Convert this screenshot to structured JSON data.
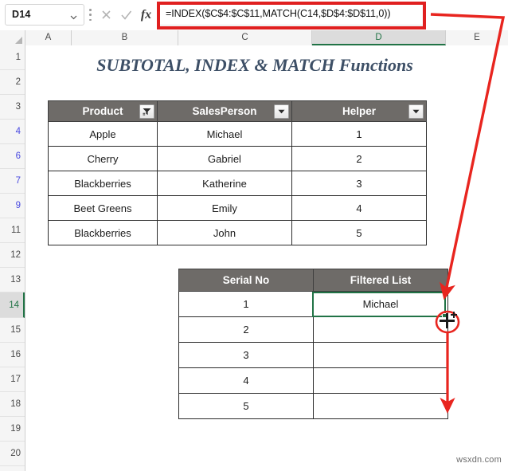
{
  "app": "spreadsheet",
  "formula_bar": {
    "name_box_value": "D14",
    "name_box_chevron_icon": "chevron-down-icon",
    "cancel_icon": "cancel-x-icon",
    "enter_icon": "enter-check-icon",
    "insert_function_icon": "fx-icon",
    "insert_function_label": "fx",
    "formula": "=INDEX($C$4:$C$11,MATCH(C14,$D$4:$D$11,0))",
    "highlight_color": "#e02020"
  },
  "column_headers": [
    "A",
    "B",
    "C",
    "D",
    "E"
  ],
  "selected_column": "D",
  "row_headers": [
    "1",
    "2",
    "3",
    "4",
    "6",
    "7",
    "9",
    "11",
    "12",
    "13",
    "14",
    "15",
    "16",
    "17",
    "18",
    "19",
    "20"
  ],
  "filtered_rows": [
    "4",
    "6",
    "7",
    "9"
  ],
  "selected_row": "14",
  "sheet": {
    "title": "SUBTOTAL, INDEX & MATCH Functions",
    "title_color": "#3d4f66",
    "header_fill": "#6e6b68",
    "selection_color": "#217346"
  },
  "table1": {
    "columns": [
      {
        "label": "Product",
        "filter_icon": "filter-applied-icon"
      },
      {
        "label": "SalesPerson",
        "filter_icon": "filter-dropdown-icon"
      },
      {
        "label": "Helper",
        "filter_icon": "filter-dropdown-icon"
      }
    ],
    "rows": [
      [
        "Apple",
        "Michael",
        "1"
      ],
      [
        "Cherry",
        "Gabriel",
        "2"
      ],
      [
        "Blackberries",
        "Katherine",
        "3"
      ],
      [
        "Beet Greens",
        "Emily",
        "4"
      ],
      [
        "Blackberries",
        "John",
        "5"
      ]
    ]
  },
  "table2": {
    "columns": [
      {
        "label": "Serial No"
      },
      {
        "label": "Filtered List"
      }
    ],
    "rows": [
      [
        "1",
        "Michael"
      ],
      [
        "2",
        ""
      ],
      [
        "3",
        ""
      ],
      [
        "4",
        ""
      ],
      [
        "5",
        ""
      ]
    ]
  },
  "annotations": {
    "arrow_color": "#e8251f",
    "fill_cursor_icon": "fill-handle-crosshair-icon",
    "diagonal_arrow": "formula-bar-to-cell-arrow",
    "down_arrow": "fill-down-arrow",
    "circle_highlight": "fill-handle-circle"
  },
  "watermark": "wsxdn.com"
}
